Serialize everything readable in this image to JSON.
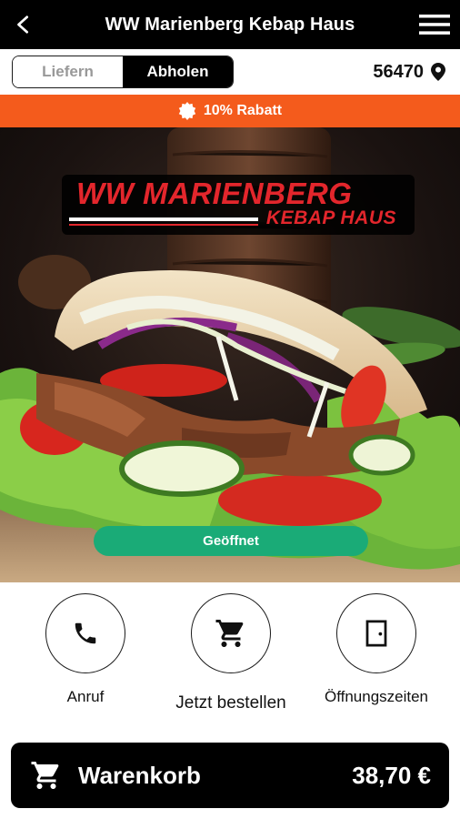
{
  "app_bar": {
    "title": "WW Marienberg Kebap Haus",
    "back_icon": "back-arrow-icon",
    "menu_icon": "hamburger-menu-icon"
  },
  "mode_toggle": {
    "options": [
      "Liefern",
      "Abholen"
    ],
    "selected": "Abholen"
  },
  "location": {
    "zip": "56470",
    "icon": "location-pin-icon"
  },
  "discount_banner": {
    "text": "10% Rabatt",
    "icon": "discount-badge-icon",
    "color": "#f45b1c"
  },
  "hero": {
    "logo_line1": "WW MARIENBERG",
    "logo_line2": "KEBAP HAUS",
    "status": "Geöffnet",
    "status_color": "#1aab77"
  },
  "actions": [
    {
      "label": "Anruf",
      "icon": "phone-icon"
    },
    {
      "label": "Jetzt bestellen",
      "icon": "shopping-cart-icon"
    },
    {
      "label": "Öffnungszeiten",
      "icon": "door-icon"
    }
  ],
  "cart": {
    "label": "Warenkorb",
    "total": "38,70 €",
    "icon": "shopping-cart-icon"
  }
}
